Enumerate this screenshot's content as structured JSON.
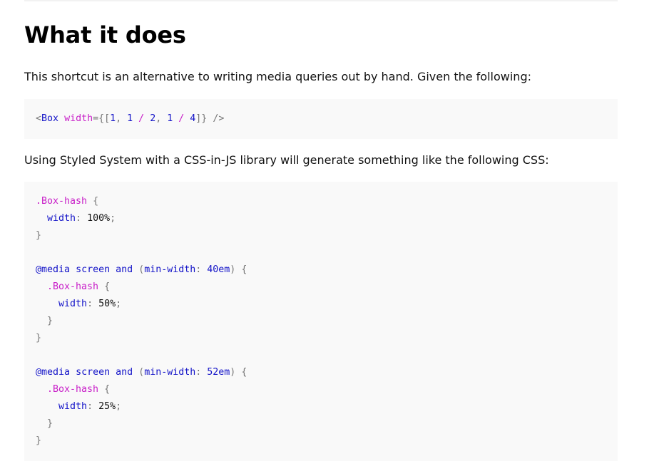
{
  "heading": "What it does",
  "intro_text": "This shortcut is an alternative to writing media queries out by hand. Given the following:",
  "jsx_example": {
    "open": "<",
    "component": "Box",
    "attr": "width",
    "eq_brace": "={[",
    "v1": "1",
    "comma1": ", ",
    "v2a": "1",
    "slash1": " / ",
    "v2b": "2",
    "comma2": ", ",
    "v3a": "1",
    "slash2": " / ",
    "v3b": "4",
    "close_brace": "]} />"
  },
  "output_text": "Using Styled System with a CSS-in-JS library will generate something like the following CSS:",
  "css_example": {
    "selector": ".Box-hash",
    "open_brace": " {",
    "close_brace": "}",
    "property": "width",
    "colon": ": ",
    "semicolon": ";",
    "media_at": "@media",
    "media_screen": "screen",
    "media_and": "and",
    "paren_open": "(",
    "media_feature": "min-width",
    "paren_close": ")",
    "base_value": "100%",
    "mq1_breakpoint": "40em",
    "mq1_value": "50%",
    "mq2_breakpoint": "52em",
    "mq2_value": "25%"
  }
}
